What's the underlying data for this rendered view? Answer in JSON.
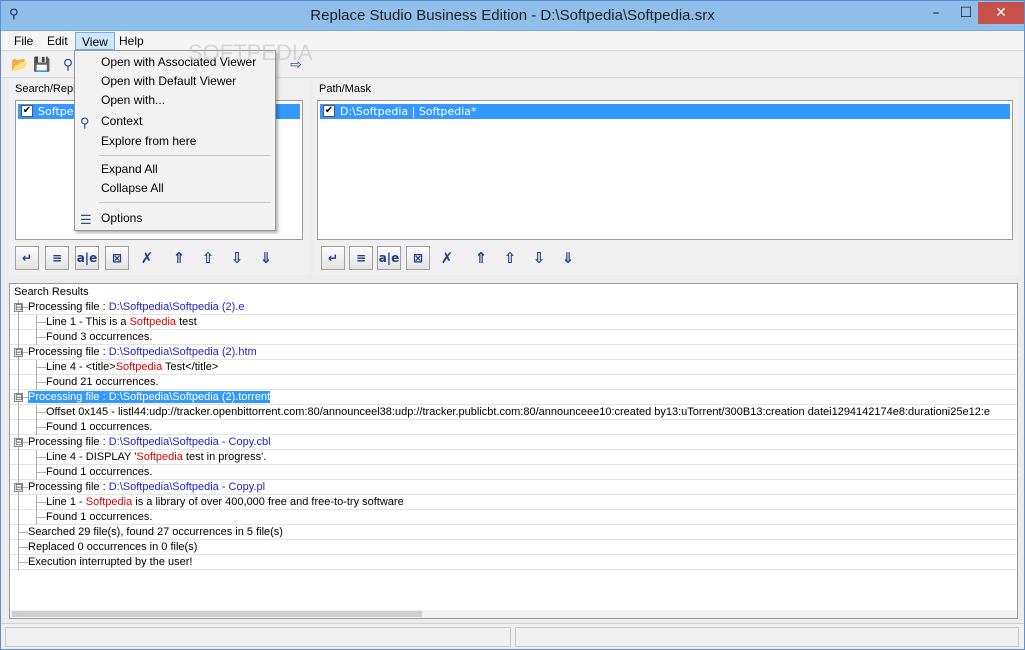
{
  "window": {
    "title": "Replace Studio Business Edition - D:\\Softpedia\\Softpedia.srx",
    "minimize": "–",
    "maximize": "☐",
    "close": "✕"
  },
  "menu": {
    "items": [
      "File",
      "Edit",
      "View",
      "Help"
    ],
    "active": "View"
  },
  "view_menu": {
    "items": [
      {
        "label": "Open with Associated Viewer",
        "icon": ""
      },
      {
        "label": "Open with Default Viewer",
        "icon": ""
      },
      {
        "label": "Open with...",
        "icon": ""
      },
      {
        "label": "Context",
        "icon": "binoculars-icon"
      },
      {
        "label": "Explore from here",
        "icon": ""
      },
      {
        "label": "Expand All",
        "icon": ""
      },
      {
        "label": "Collapse All",
        "icon": ""
      },
      {
        "label": "Options",
        "icon": "options-icon"
      }
    ]
  },
  "left_panel": {
    "label": "Search/Repla",
    "row_text": "Softped"
  },
  "right_panel": {
    "label": "Path/Mask",
    "row_text": "D:\\Softpedia | Softpedia*"
  },
  "panel_buttons": [
    "replace-selected",
    "replace-all",
    "case",
    "exclude",
    "clear",
    "move-top",
    "move-up",
    "move-down",
    "move-bottom"
  ],
  "results": {
    "header": "Search Results",
    "rows": [
      {
        "level": 0,
        "toggle": "⊟",
        "prefix": "Processing file : ",
        "path": "D:\\Softpedia\\Softpedia (2).e",
        "selected": false
      },
      {
        "level": 1,
        "pre": "Line    1 - This is a ",
        "hl": "Softpedia",
        "post": " test"
      },
      {
        "level": 1,
        "pre": "Found 3 occurrences.",
        "hl": "",
        "post": ""
      },
      {
        "level": 0,
        "toggle": "⊟",
        "prefix": "Processing file : ",
        "path": "D:\\Softpedia\\Softpedia (2).htm",
        "selected": false
      },
      {
        "level": 1,
        "pre": "Line    4 - <title>",
        "hl": "Softpedia",
        "post": " Test</title>"
      },
      {
        "level": 1,
        "pre": "Found 21 occurrences.",
        "hl": "",
        "post": ""
      },
      {
        "level": 0,
        "toggle": "⊟",
        "prefix": "Processing file : ",
        "path": "D:\\Softpedia\\Softpedia (2).torrent",
        "selected": true
      },
      {
        "level": 1,
        "pre": "Offset 0x145    - listl44:udp://tracker.openbittorrent.com:80/announceel38:udp://tracker.publicbt.com:80/announceee10:created by13:uTorrent/300B13:creation datei1294142174e8:durationi25e12:e",
        "hl": "",
        "post": ""
      },
      {
        "level": 1,
        "pre": "Found 1 occurrences.",
        "hl": "",
        "post": ""
      },
      {
        "level": 0,
        "toggle": "⊟",
        "prefix": "Processing file : ",
        "path": "D:\\Softpedia\\Softpedia - Copy.cbl",
        "selected": false
      },
      {
        "level": 1,
        "pre": "Line    4 -            DISPLAY '",
        "hl": "Softpedia",
        "post": " test in progress'."
      },
      {
        "level": 1,
        "pre": "Found 1 occurrences.",
        "hl": "",
        "post": ""
      },
      {
        "level": 0,
        "toggle": "⊟",
        "prefix": "Processing file : ",
        "path": "D:\\Softpedia\\Softpedia - Copy.pl",
        "selected": false
      },
      {
        "level": 1,
        "pre": "Line    1 - ",
        "hl": "Softpedia",
        "post": " is a library of over 400,000 free and free-to-try software"
      },
      {
        "level": 1,
        "pre": "Found 1 occurrences.",
        "hl": "",
        "post": ""
      },
      {
        "level": 0,
        "toggle": "",
        "prefix": "Searched 29 file(s), found 27 occurrences in 5 file(s)",
        "path": "",
        "selected": false
      },
      {
        "level": 0,
        "toggle": "",
        "prefix": "Replaced 0 occurrences in 0 file(s)",
        "path": "",
        "selected": false
      },
      {
        "level": 0,
        "toggle": "",
        "prefix": "Execution interrupted by the user!",
        "path": "",
        "selected": false
      }
    ]
  },
  "watermark": "SOFTPEDIA",
  "colors": {
    "selection": "#3399ff",
    "path_blue": "#2222cc",
    "highlight_red": "#dd0000",
    "title_bar": "#8fbeeb"
  }
}
